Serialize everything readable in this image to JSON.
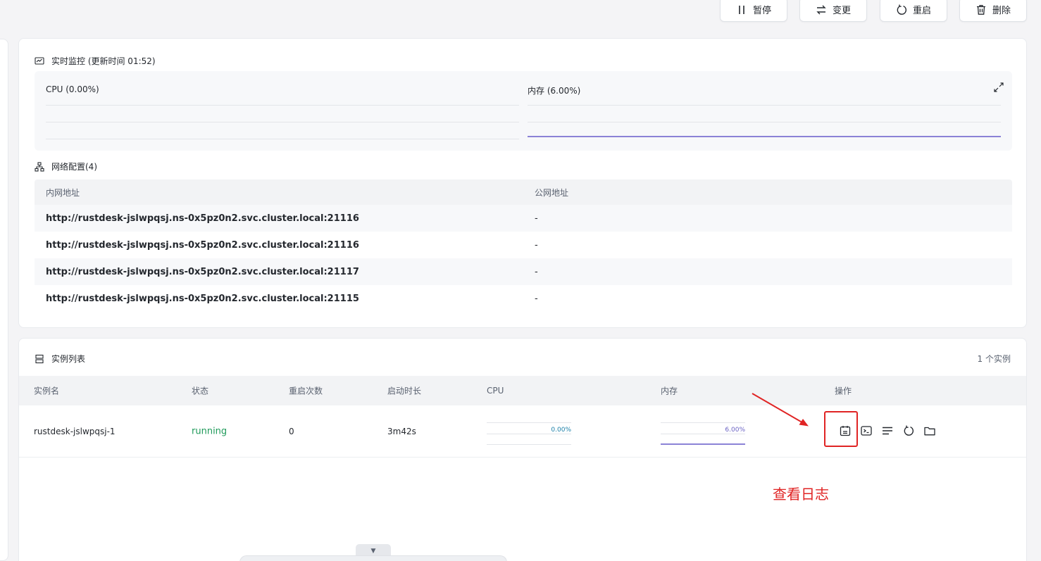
{
  "actions": [
    {
      "label": "暂停",
      "icon": "pause-icon"
    },
    {
      "label": "变更",
      "icon": "swap-icon"
    },
    {
      "label": "重启",
      "icon": "restart-icon"
    },
    {
      "label": "删除",
      "icon": "trash-icon"
    }
  ],
  "monitor": {
    "title": "实时监控 (更新时间 01:52)",
    "cpu_label": "CPU (0.00%)",
    "mem_label": "内存 (6.00%)",
    "expand_icon": "expand-icon"
  },
  "network": {
    "title": "网络配置(4)",
    "headers": [
      "内网地址",
      "公网地址"
    ],
    "rows": [
      {
        "internal": "http://rustdesk-jslwpqsj.ns-0x5pz0n2.svc.cluster.local:21116",
        "public": "-"
      },
      {
        "internal": "http://rustdesk-jslwpqsj.ns-0x5pz0n2.svc.cluster.local:21116",
        "public": "-"
      },
      {
        "internal": "http://rustdesk-jslwpqsj.ns-0x5pz0n2.svc.cluster.local:21117",
        "public": "-"
      },
      {
        "internal": "http://rustdesk-jslwpqsj.ns-0x5pz0n2.svc.cluster.local:21115",
        "public": "-"
      }
    ]
  },
  "instances": {
    "title": "实例列表",
    "count": "1 个实例",
    "headers": {
      "name": "实例名",
      "status": "状态",
      "restarts": "重启次数",
      "uptime": "启动时长",
      "cpu": "CPU",
      "mem": "内存",
      "ops": "操作"
    },
    "rows": [
      {
        "name": "rustdesk-jslwpqsj-1",
        "status": "running",
        "restarts": "0",
        "uptime": "3m42s",
        "cpu": "0.00%",
        "mem": "6.00%"
      }
    ]
  },
  "annotation": "查看日志",
  "colors": {
    "status_running": "#1f9a5a",
    "annotation": "#e02424",
    "mem_line": "#8b82d6",
    "cpu_text": "#1a7fa8"
  }
}
